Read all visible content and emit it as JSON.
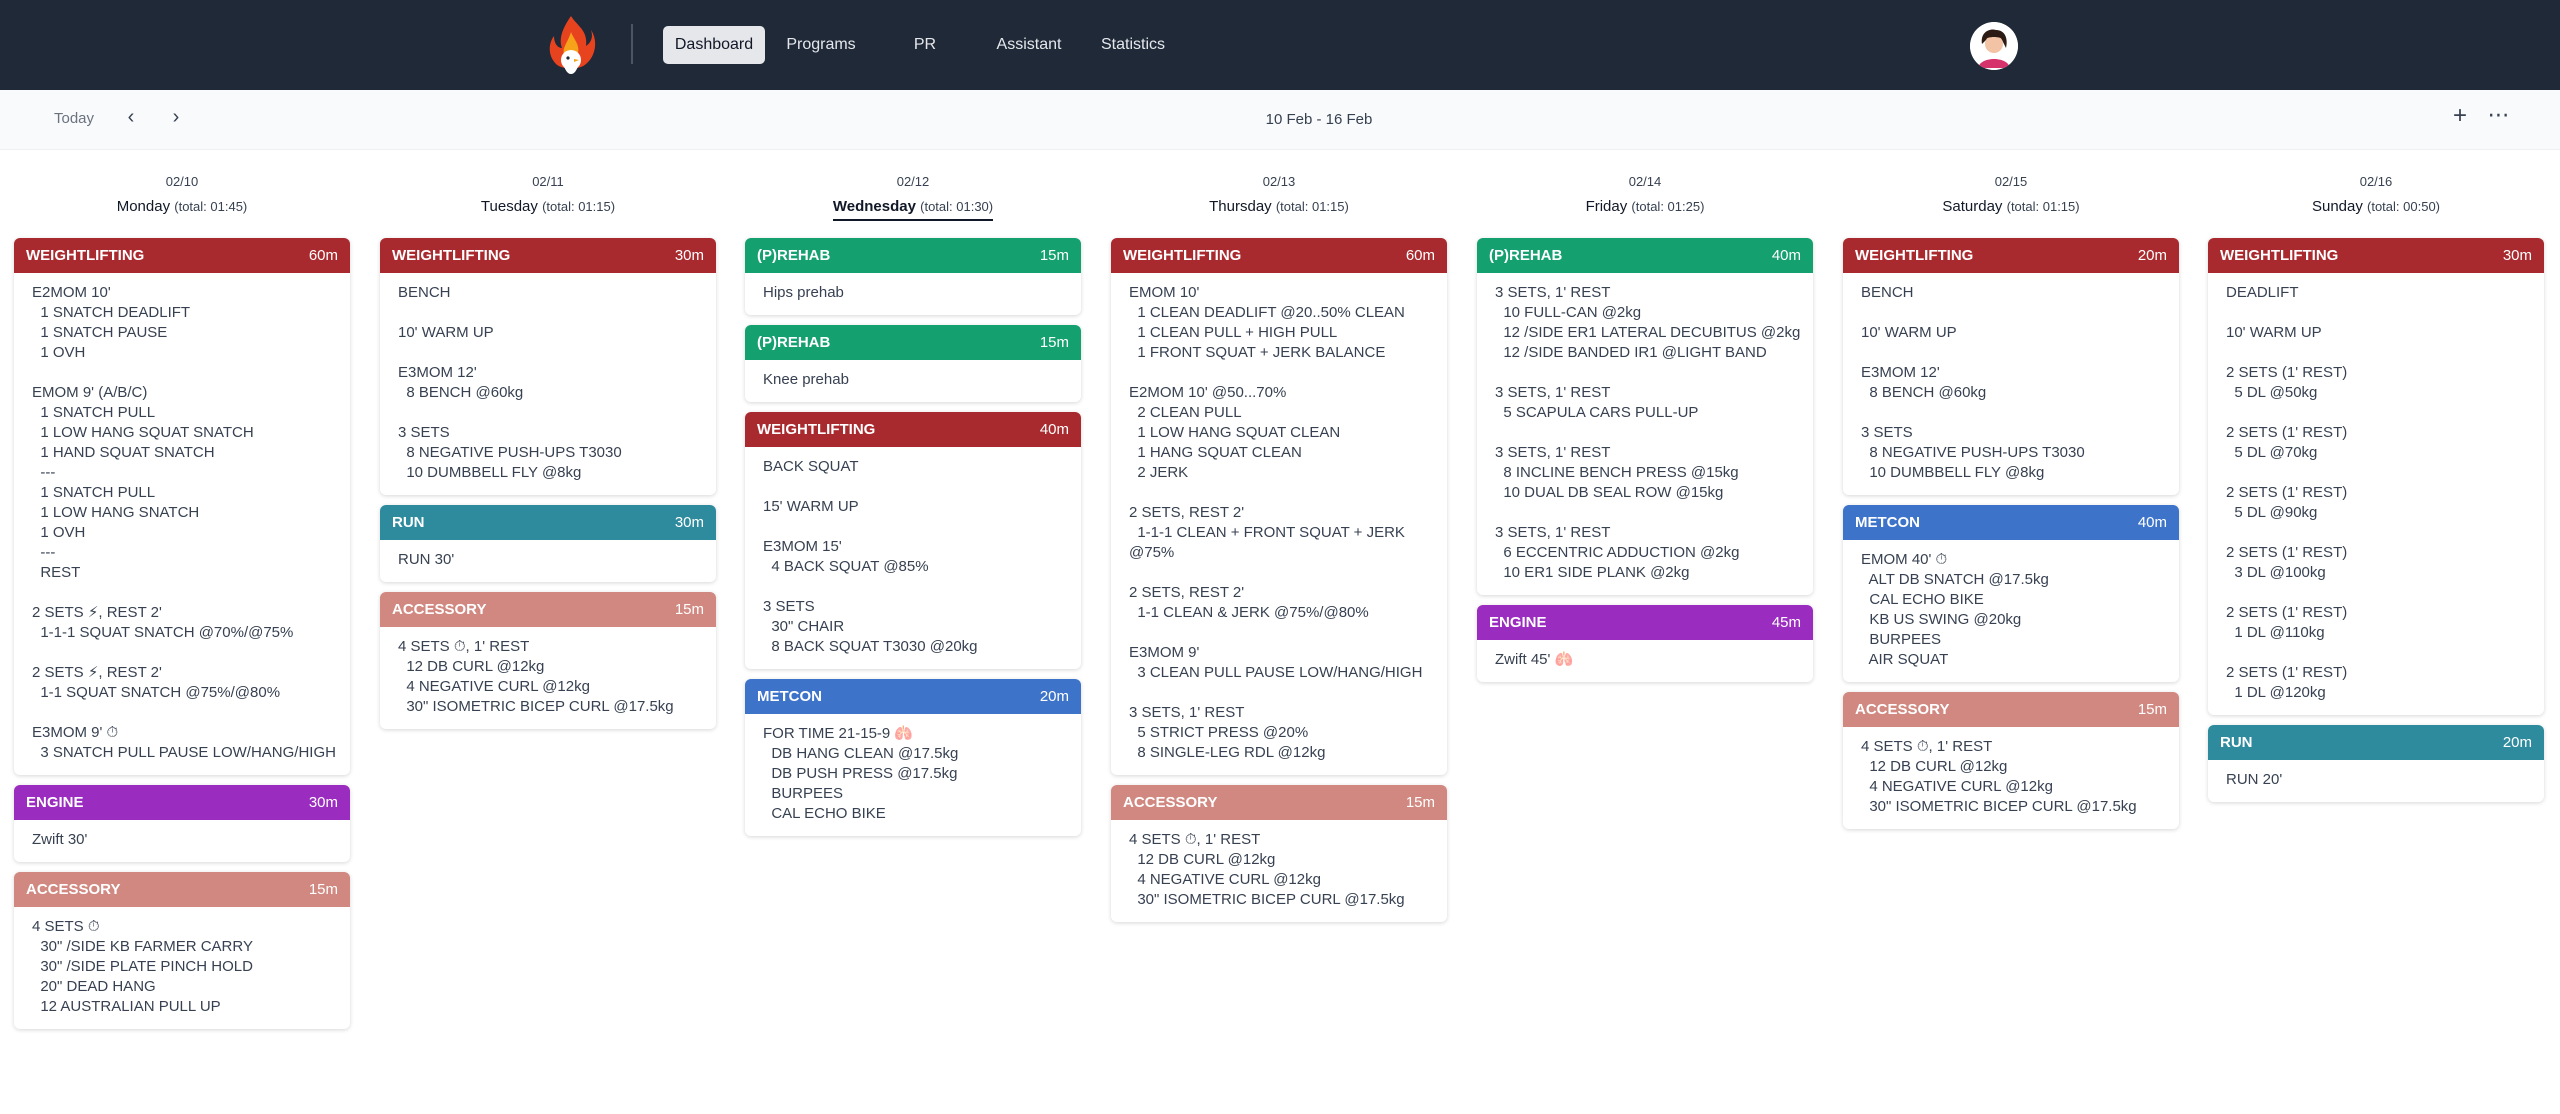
{
  "nav": {
    "items": [
      "Dashboard",
      "Programs",
      "PR",
      "Assistant",
      "Statistics"
    ],
    "active": "Dashboard"
  },
  "toolbar": {
    "today": "Today",
    "prev_icon": "chevron-left-icon",
    "next_icon": "chevron-right-icon",
    "date_range": "10 Feb - 16 Feb",
    "add_icon": "plus-icon",
    "more_icon": "more-horizontal-icon"
  },
  "colors": {
    "topbar": "#1f2937",
    "weightlifting": "#a92a2e",
    "prehab": "#14a06f",
    "run": "#2e8b9e",
    "accessory": "#d08880",
    "engine": "#9b2cc0",
    "metcon": "#3d74c9"
  },
  "days": [
    {
      "date": "02/10",
      "name": "Monday",
      "total": "(total: 01:45)",
      "current": false,
      "cards": [
        {
          "type": "WEIGHTLIFTING",
          "kind": "weightlifting",
          "duration": "60m",
          "lines": [
            "E2MOM 10'",
            "  1 SNATCH DEADLIFT",
            "  1 SNATCH PAUSE",
            "  1 OVH",
            "",
            "EMOM 9' (A/B/C)",
            "  1 SNATCH PULL",
            "  1 LOW HANG SQUAT SNATCH",
            "  1 HAND SQUAT SNATCH",
            "  ---",
            "  1 SNATCH PULL",
            "  1 LOW HANG SNATCH",
            "  1 OVH",
            "  ---",
            "  REST",
            "",
            "2 SETS ⚡, REST 2'",
            "  1-1-1 SQUAT SNATCH @70%/@75%",
            "",
            "2 SETS ⚡, REST 2'",
            "  1-1 SQUAT SNATCH @75%/@80%",
            "",
            "E3MOM 9' ⏱",
            "  3 SNATCH PULL PAUSE LOW/HANG/HIGH"
          ]
        },
        {
          "type": "ENGINE",
          "kind": "engine",
          "duration": "30m",
          "lines": [
            "Zwift 30'"
          ]
        },
        {
          "type": "ACCESSORY",
          "kind": "accessory",
          "duration": "15m",
          "lines": [
            "4 SETS ⏱",
            "  30\" /SIDE KB FARMER CARRY",
            "  30\" /SIDE PLATE PINCH HOLD",
            "  20\" DEAD HANG",
            "  12 AUSTRALIAN PULL UP"
          ]
        }
      ]
    },
    {
      "date": "02/11",
      "name": "Tuesday",
      "total": "(total: 01:15)",
      "current": false,
      "cards": [
        {
          "type": "WEIGHTLIFTING",
          "kind": "weightlifting",
          "duration": "30m",
          "lines": [
            "BENCH",
            "",
            "10' WARM UP",
            "",
            "E3MOM 12'",
            "  8 BENCH @60kg",
            "",
            "3 SETS",
            "  8 NEGATIVE PUSH-UPS T3030",
            "  10 DUMBBELL FLY @8kg"
          ]
        },
        {
          "type": "RUN",
          "kind": "run",
          "duration": "30m",
          "lines": [
            "RUN 30'"
          ]
        },
        {
          "type": "ACCESSORY",
          "kind": "accessory",
          "duration": "15m",
          "lines": [
            "4 SETS ⏱, 1' REST",
            "  12 DB CURL @12kg",
            "  4 NEGATIVE CURL @12kg",
            "  30\" ISOMETRIC BICEP CURL @17.5kg"
          ]
        }
      ]
    },
    {
      "date": "02/12",
      "name": "Wednesday",
      "total": "(total: 01:30)",
      "current": true,
      "cards": [
        {
          "type": "(P)REHAB",
          "kind": "prehab",
          "duration": "15m",
          "lines": [
            "Hips prehab"
          ]
        },
        {
          "type": "(P)REHAB",
          "kind": "prehab",
          "duration": "15m",
          "lines": [
            "Knee prehab"
          ]
        },
        {
          "type": "WEIGHTLIFTING",
          "kind": "weightlifting",
          "duration": "40m",
          "lines": [
            "BACK SQUAT",
            "",
            "15' WARM UP",
            "",
            "E3MOM 15'",
            "  4 BACK SQUAT @85%",
            "",
            "3 SETS",
            "  30\" CHAIR",
            "  8 BACK SQUAT T3030 @20kg"
          ]
        },
        {
          "type": "METCON",
          "kind": "metcon",
          "duration": "20m",
          "lines": [
            "FOR TIME 21-15-9 🫁",
            "  DB HANG CLEAN @17.5kg",
            "  DB PUSH PRESS @17.5kg",
            "  BURPEES",
            "  CAL ECHO BIKE"
          ]
        }
      ]
    },
    {
      "date": "02/13",
      "name": "Thursday",
      "total": "(total: 01:15)",
      "current": false,
      "cards": [
        {
          "type": "WEIGHTLIFTING",
          "kind": "weightlifting",
          "duration": "60m",
          "lines": [
            "EMOM 10'",
            "  1 CLEAN DEADLIFT @20..50% CLEAN",
            "  1 CLEAN PULL + HIGH PULL",
            "  1 FRONT SQUAT + JERK BALANCE",
            "",
            "E2MOM 10' @50...70%",
            "  2 CLEAN PULL",
            "  1 LOW HANG SQUAT CLEAN",
            "  1 HANG SQUAT CLEAN",
            "  2 JERK",
            "",
            "2 SETS, REST 2'",
            "  1-1-1 CLEAN + FRONT SQUAT + JERK",
            "@75%",
            "",
            "2 SETS, REST 2'",
            "  1-1 CLEAN & JERK @75%/@80%",
            "",
            "E3MOM 9'",
            "  3 CLEAN PULL PAUSE LOW/HANG/HIGH",
            "",
            "3 SETS, 1' REST",
            "  5 STRICT PRESS @20%",
            "  8 SINGLE-LEG RDL @12kg"
          ]
        },
        {
          "type": "ACCESSORY",
          "kind": "accessory",
          "duration": "15m",
          "lines": [
            "4 SETS ⏱, 1' REST",
            "  12 DB CURL @12kg",
            "  4 NEGATIVE CURL @12kg",
            "  30\" ISOMETRIC BICEP CURL @17.5kg"
          ]
        }
      ]
    },
    {
      "date": "02/14",
      "name": "Friday",
      "total": "(total: 01:25)",
      "current": false,
      "cards": [
        {
          "type": "(P)REHAB",
          "kind": "prehab",
          "duration": "40m",
          "lines": [
            "3 SETS, 1' REST",
            "  10 FULL-CAN @2kg",
            "  12 /SIDE ER1 LATERAL DECUBITUS @2kg",
            "  12 /SIDE BANDED IR1 @LIGHT BAND",
            "",
            "3 SETS, 1' REST",
            "  5 SCAPULA CARS PULL-UP",
            "",
            "3 SETS, 1' REST",
            "  8 INCLINE BENCH PRESS @15kg",
            "  10 DUAL DB SEAL ROW @15kg",
            "",
            "3 SETS, 1' REST",
            "  6 ECCENTRIC ADDUCTION @2kg",
            "  10 ER1 SIDE PLANK @2kg"
          ]
        },
        {
          "type": "ENGINE",
          "kind": "engine",
          "duration": "45m",
          "lines": [
            "Zwift 45' 🫁"
          ]
        }
      ]
    },
    {
      "date": "02/15",
      "name": "Saturday",
      "total": "(total: 01:15)",
      "current": false,
      "cards": [
        {
          "type": "WEIGHTLIFTING",
          "kind": "weightlifting",
          "duration": "20m",
          "lines": [
            "BENCH",
            "",
            "10' WARM UP",
            "",
            "E3MOM 12'",
            "  8 BENCH @60kg",
            "",
            "3 SETS",
            "  8 NEGATIVE PUSH-UPS T3030",
            "  10 DUMBBELL FLY @8kg"
          ]
        },
        {
          "type": "METCON",
          "kind": "metcon",
          "duration": "40m",
          "lines": [
            "EMOM 40' ⏱",
            "  ALT DB SNATCH @17.5kg",
            "  CAL ECHO BIKE",
            "  KB US SWING @20kg",
            "  BURPEES",
            "  AIR SQUAT"
          ]
        },
        {
          "type": "ACCESSORY",
          "kind": "accessory",
          "duration": "15m",
          "lines": [
            "4 SETS ⏱, 1' REST",
            "  12 DB CURL @12kg",
            "  4 NEGATIVE CURL @12kg",
            "  30\" ISOMETRIC BICEP CURL @17.5kg"
          ]
        }
      ]
    },
    {
      "date": "02/16",
      "name": "Sunday",
      "total": "(total: 00:50)",
      "current": false,
      "cards": [
        {
          "type": "WEIGHTLIFTING",
          "kind": "weightlifting",
          "duration": "30m",
          "lines": [
            "DEADLIFT",
            "",
            "10' WARM UP",
            "",
            "2 SETS (1' REST)",
            "  5 DL @50kg",
            "",
            "2 SETS (1' REST)",
            "  5 DL @70kg",
            "",
            "2 SETS (1' REST)",
            "  5 DL @90kg",
            "",
            "2 SETS (1' REST)",
            "  3 DL @100kg",
            "",
            "2 SETS (1' REST)",
            "  1 DL @110kg",
            "",
            "2 SETS (1' REST)",
            "  1 DL @120kg"
          ]
        },
        {
          "type": "RUN",
          "kind": "run",
          "duration": "20m",
          "lines": [
            "RUN 20'"
          ]
        }
      ]
    }
  ]
}
